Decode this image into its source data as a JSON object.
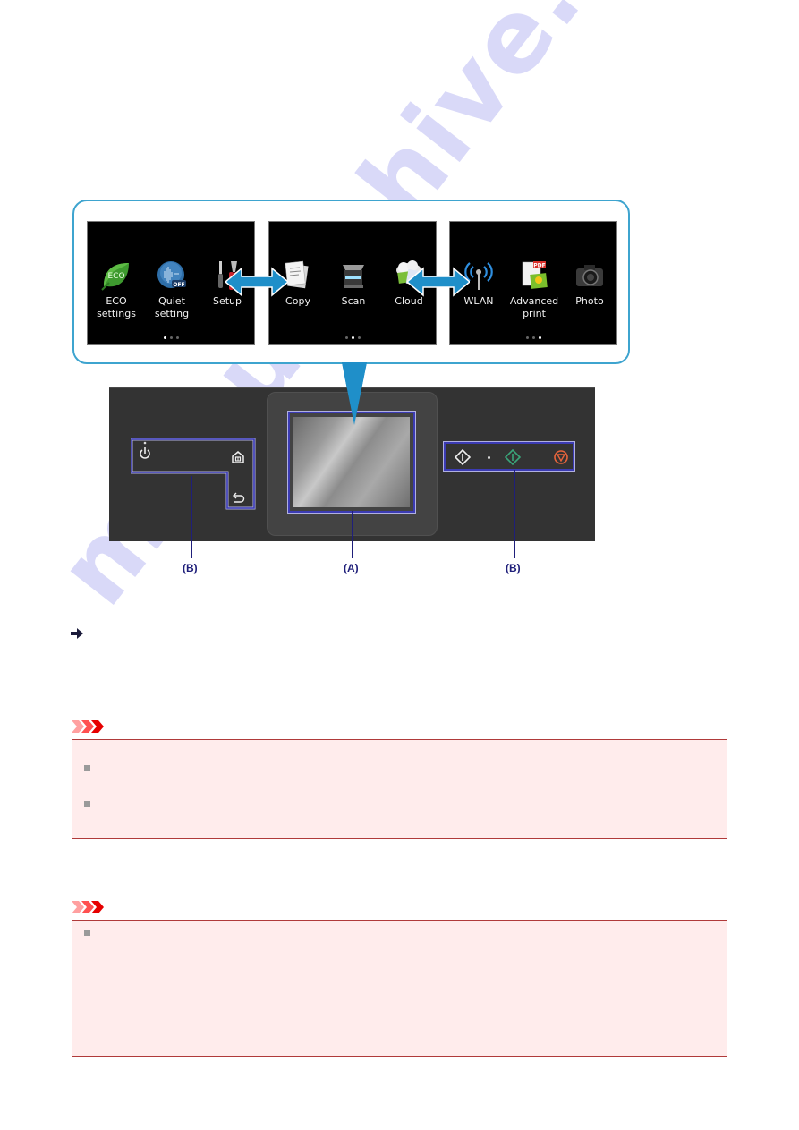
{
  "home_screens": [
    {
      "name": "home-screen-1",
      "page_indicator": {
        "total": 3,
        "active": 1
      },
      "apps": [
        {
          "label_line1": "ECO",
          "label_line2": "settings",
          "icon": "eco-leaf-icon"
        },
        {
          "label_line1": "Quiet",
          "label_line2": "setting",
          "icon": "quiet-off-icon"
        },
        {
          "label_line1": "Setup",
          "label_line2": "",
          "icon": "tools-icon"
        }
      ]
    },
    {
      "name": "home-screen-2",
      "page_indicator": {
        "total": 3,
        "active": 2
      },
      "apps": [
        {
          "label_line1": "Copy",
          "label_line2": "",
          "icon": "copy-documents-icon"
        },
        {
          "label_line1": "Scan",
          "label_line2": "",
          "icon": "scanner-icon"
        },
        {
          "label_line1": "Cloud",
          "label_line2": "",
          "icon": "cloud-icon"
        }
      ]
    },
    {
      "name": "home-screen-3",
      "page_indicator": {
        "total": 3,
        "active": 3
      },
      "apps": [
        {
          "label_line1": "WLAN",
          "label_line2": "",
          "icon": "wlan-antenna-icon"
        },
        {
          "label_line1": "Advanced",
          "label_line2": "print",
          "icon": "pdf-print-icon"
        },
        {
          "label_line1": "Photo",
          "label_line2": "",
          "icon": "camera-icon"
        }
      ]
    }
  ],
  "control_panel": {
    "left_buttons": [
      "power-icon",
      "home-icon",
      "back-icon"
    ],
    "right_buttons": [
      "black-start-icon",
      "color-start-icon",
      "stop-icon"
    ],
    "labels": {
      "left": "(B)",
      "center": "(A)",
      "right": "(B)"
    }
  },
  "watermark": "manualshive.com",
  "colors": {
    "callout_border": "#3ea4cf",
    "arrow_blue": "#1f8fc9",
    "leader_line": "#1f1f7a",
    "panel_bg": "#333333",
    "notice_bg": "#ffecec",
    "notice_border": "#b03a3a",
    "color_start": "#3aa57a",
    "stop": "#e8643c"
  },
  "notices": [
    {
      "type": "important",
      "bullets": 2
    },
    {
      "type": "important",
      "bullets": 1
    }
  ]
}
